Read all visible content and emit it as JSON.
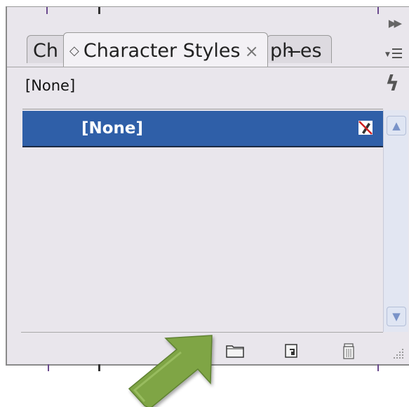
{
  "panel": {
    "tabs": [
      {
        "label": "Ch"
      },
      {
        "label": "Character Styles",
        "active": true
      },
      {
        "label": "ph  ̶es"
      }
    ],
    "current_style": "[None]",
    "list": {
      "items": [
        {
          "label": "[None]",
          "selected": true
        }
      ]
    },
    "footer_icons": [
      "style-group-folder-icon",
      "new-style-icon",
      "delete-style-icon"
    ],
    "colors": {
      "selection": "#2f5fa8",
      "panel_bg": "#e9e6ec",
      "pointer_arrow": "#7fa545"
    }
  }
}
